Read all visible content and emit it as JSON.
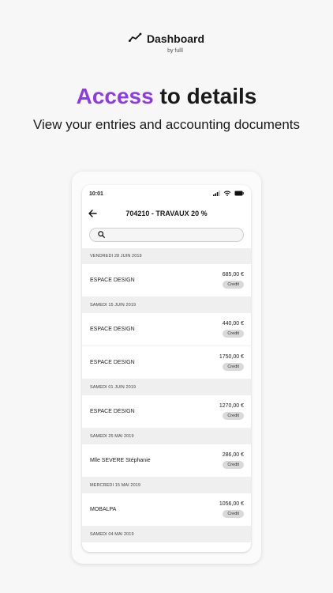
{
  "brand": {
    "title": "Dashboard",
    "subtitle": "by fulll"
  },
  "headline": {
    "accent": "Access",
    "rest": " to details"
  },
  "subline": "View your entries and accounting documents",
  "phone": {
    "time": "10:01",
    "title": "704210 - TRAVAUX 20 %",
    "search_placeholder": "",
    "groups": [
      {
        "date": "VENDREDI 28 JUIN 2019",
        "entries": [
          {
            "name": "ESPACE DESIGN",
            "amount": "685,00 €",
            "badge": "Credit"
          }
        ]
      },
      {
        "date": "SAMEDI 15 JUIN 2019",
        "entries": [
          {
            "name": "ESPACE DESIGN",
            "amount": "440,00 €",
            "badge": "Credit"
          },
          {
            "name": "ESPACE DESIGN",
            "amount": "1750,00 €",
            "badge": "Credit"
          }
        ]
      },
      {
        "date": "SAMEDI 01 JUIN 2019",
        "entries": [
          {
            "name": "ESPACE DESIGN",
            "amount": "1270,00 €",
            "badge": "Credit"
          }
        ]
      },
      {
        "date": "SAMEDI 25 MAI 2019",
        "entries": [
          {
            "name": "Mlle SEVERE Stéphanie",
            "amount": "286,00 €",
            "badge": "Credit"
          }
        ]
      },
      {
        "date": "MERCREDI 15 MAI 2019",
        "entries": [
          {
            "name": "MOBALPA",
            "amount": "1056,00 €",
            "badge": "Credit"
          }
        ]
      },
      {
        "date": "SAMEDI 04 MAI 2019",
        "entries": []
      }
    ]
  },
  "colors": {
    "accent": "#8b3be6",
    "background": "#f7f7f8"
  },
  "icons": {
    "brand": "trend-line-icon",
    "back": "arrow-left-icon",
    "search": "search-icon",
    "signal": "signal-icon",
    "wifi": "wifi-icon",
    "battery": "battery-icon"
  }
}
